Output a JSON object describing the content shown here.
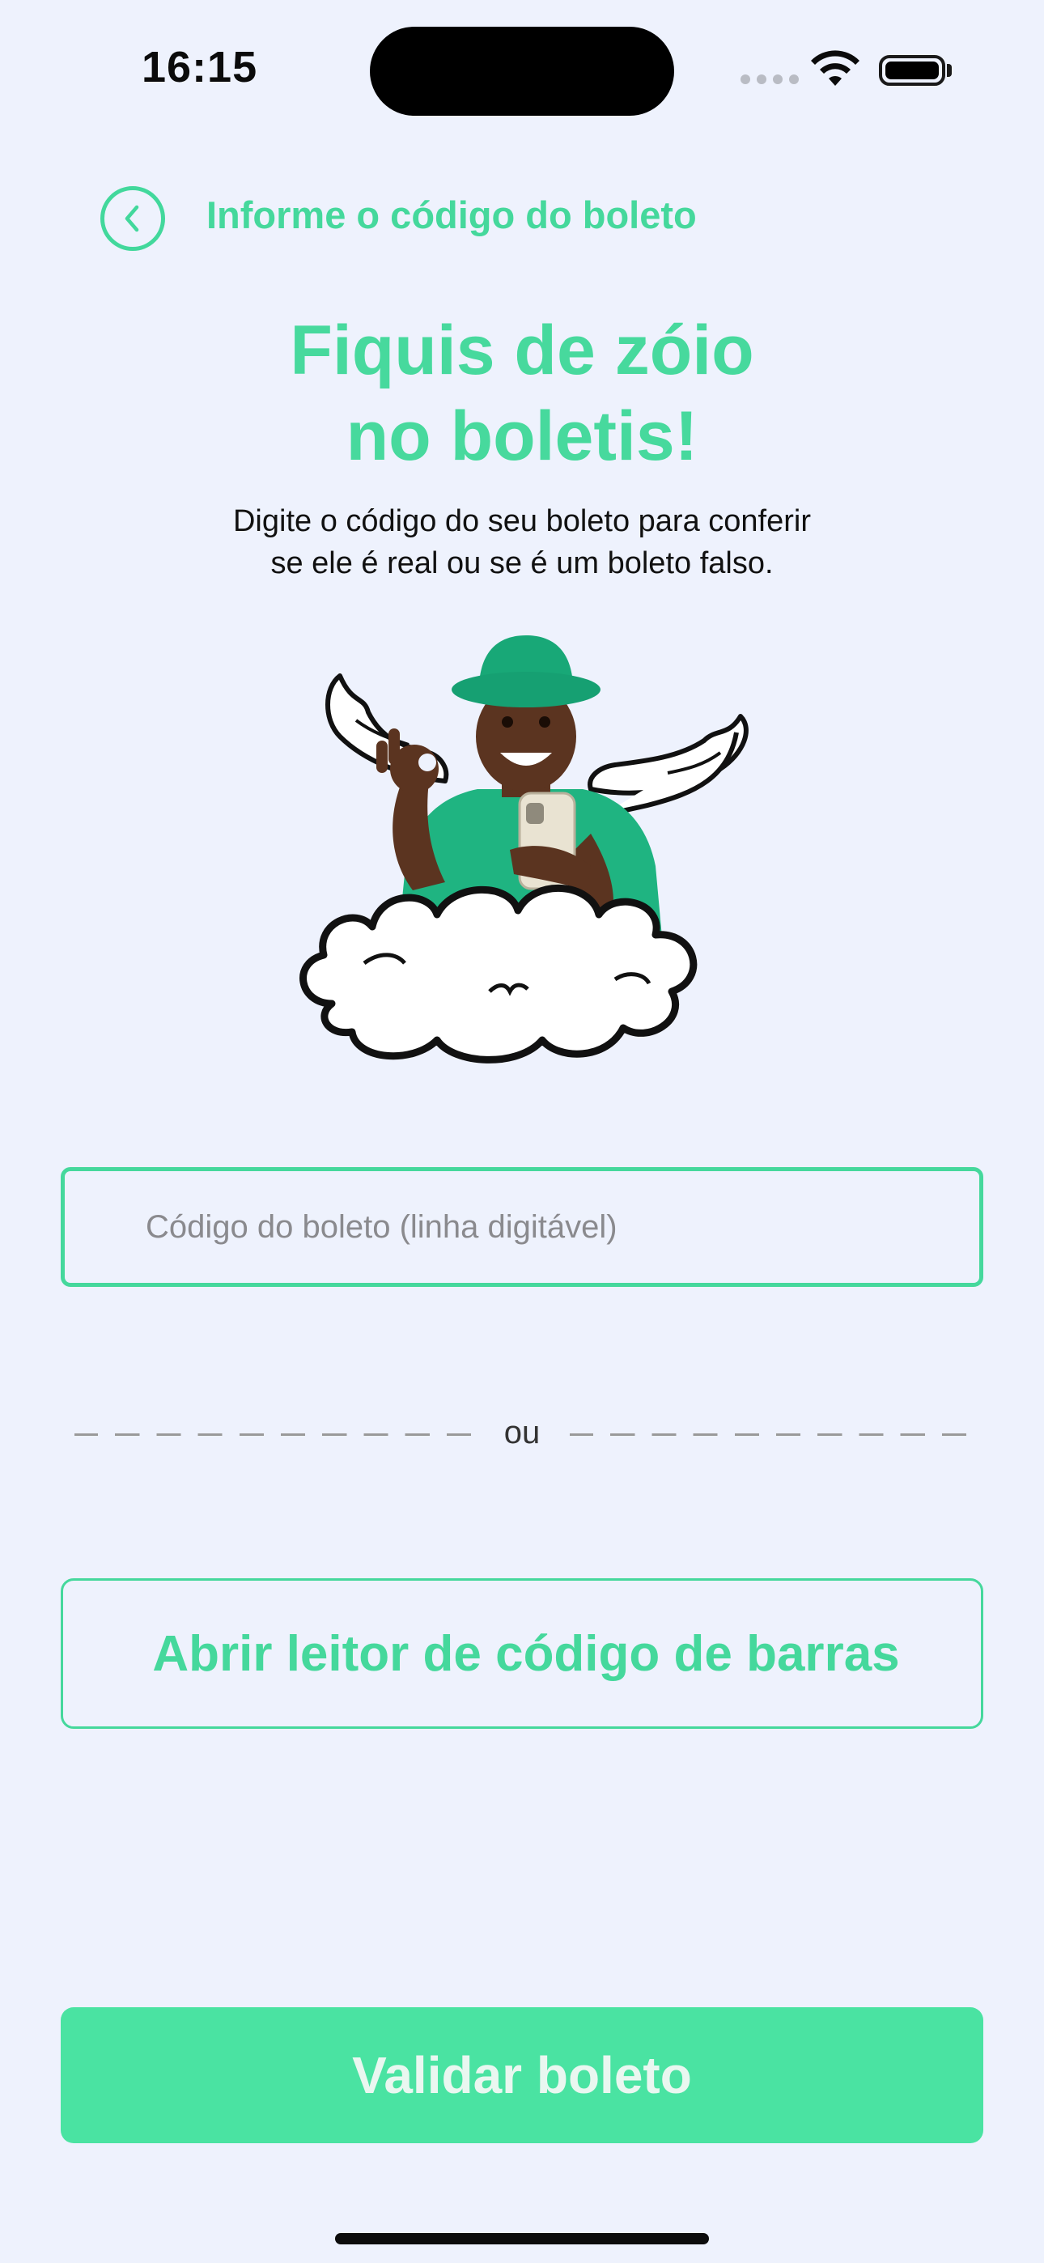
{
  "status_bar": {
    "time": "16:15"
  },
  "header": {
    "back_icon": "chevron-left-icon",
    "title": "Informe o código do boleto"
  },
  "hero": {
    "title_line1": "Fiquis de zóio",
    "title_line2": "no boletis!",
    "subtitle_line1": "Digite o código do seu boleto para conferir",
    "subtitle_line2": "se ele é real ou se é um boleto falso."
  },
  "form": {
    "code_input_placeholder": "Código do boleto (linha digitável)",
    "code_input_value": ""
  },
  "divider": {
    "text": "ou"
  },
  "scanner": {
    "label": "Abrir leitor de código de barras"
  },
  "validate": {
    "label": "Validar boleto"
  },
  "colors": {
    "background": "#eef2fd",
    "accent": "#45d89c",
    "button_fill": "#4ae3a2"
  }
}
